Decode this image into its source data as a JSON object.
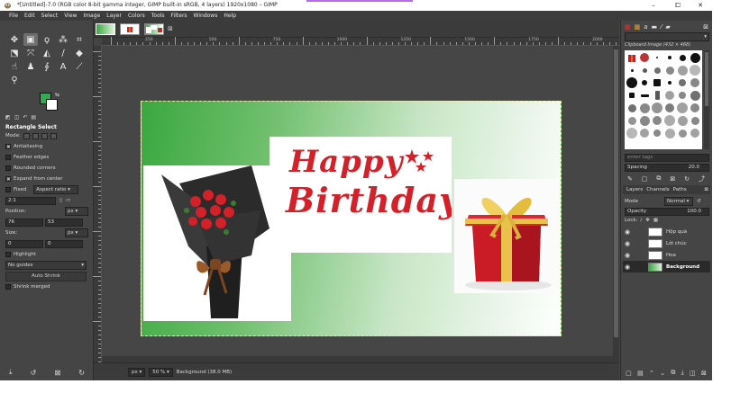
{
  "window": {
    "title": "*[Untitled]-7.0 (RGB color 8-bit gamma integer, GIMP built-in sRGB, 4 layers) 1920x1080 – GIMP",
    "controls": [
      "–",
      "⧠",
      "✕"
    ]
  },
  "menu": [
    "File",
    "Edit",
    "Select",
    "View",
    "Image",
    "Layer",
    "Colors",
    "Tools",
    "Filters",
    "Windows",
    "Help"
  ],
  "colors": {
    "foreground": "#34a853",
    "background": "#ffffff",
    "accent": "#d42028"
  },
  "tool_options": {
    "title": "Rectangle Select",
    "mode_label": "Mode:",
    "antialiasing": "Antialiasing",
    "feather_edges": "Feather edges",
    "rounded_corners": "Rounded corners",
    "expand_from_center": "Expand from center",
    "fixed_label": "Fixed",
    "fixed_value": "Aspect ratio",
    "ratio_value": "2:1",
    "position_label": "Position:",
    "position_unit": "px",
    "position_x": "76",
    "position_y": "53",
    "size_label": "Size:",
    "size_unit": "px",
    "size_w": "0",
    "size_h": "0",
    "highlight": "Highlight",
    "guides_value": "No guides",
    "auto_shrink": "Auto Shrink",
    "shrink_merged": "Shrink merged"
  },
  "ruler": {
    "labels": [
      "250",
      "500",
      "750",
      "1000",
      "1250",
      "1500",
      "1750",
      "2000"
    ]
  },
  "image": {
    "greeting_line1": "Happy",
    "greeting_line2": "Birthday"
  },
  "status": {
    "unit": "px",
    "zoom": "50 %",
    "info": "Background (38.0 MB)"
  },
  "brushes": {
    "title": "Clipboard Image (432 × 468)",
    "filter_placeholder": "enter tags",
    "spacing_label": "Spacing",
    "spacing_value": "20.0"
  },
  "layers": {
    "tabs": [
      "Layers",
      "Channels",
      "Paths"
    ],
    "mode_label": "Mode",
    "mode_value": "Normal",
    "opacity_label": "Opacity",
    "opacity_value": "100.0",
    "lock_label": "Lock:",
    "items": [
      {
        "name": "Hộp quà",
        "active": false
      },
      {
        "name": "Lời chúc",
        "active": false
      },
      {
        "name": "Hoa",
        "active": false
      },
      {
        "name": "Background",
        "active": true
      }
    ]
  }
}
